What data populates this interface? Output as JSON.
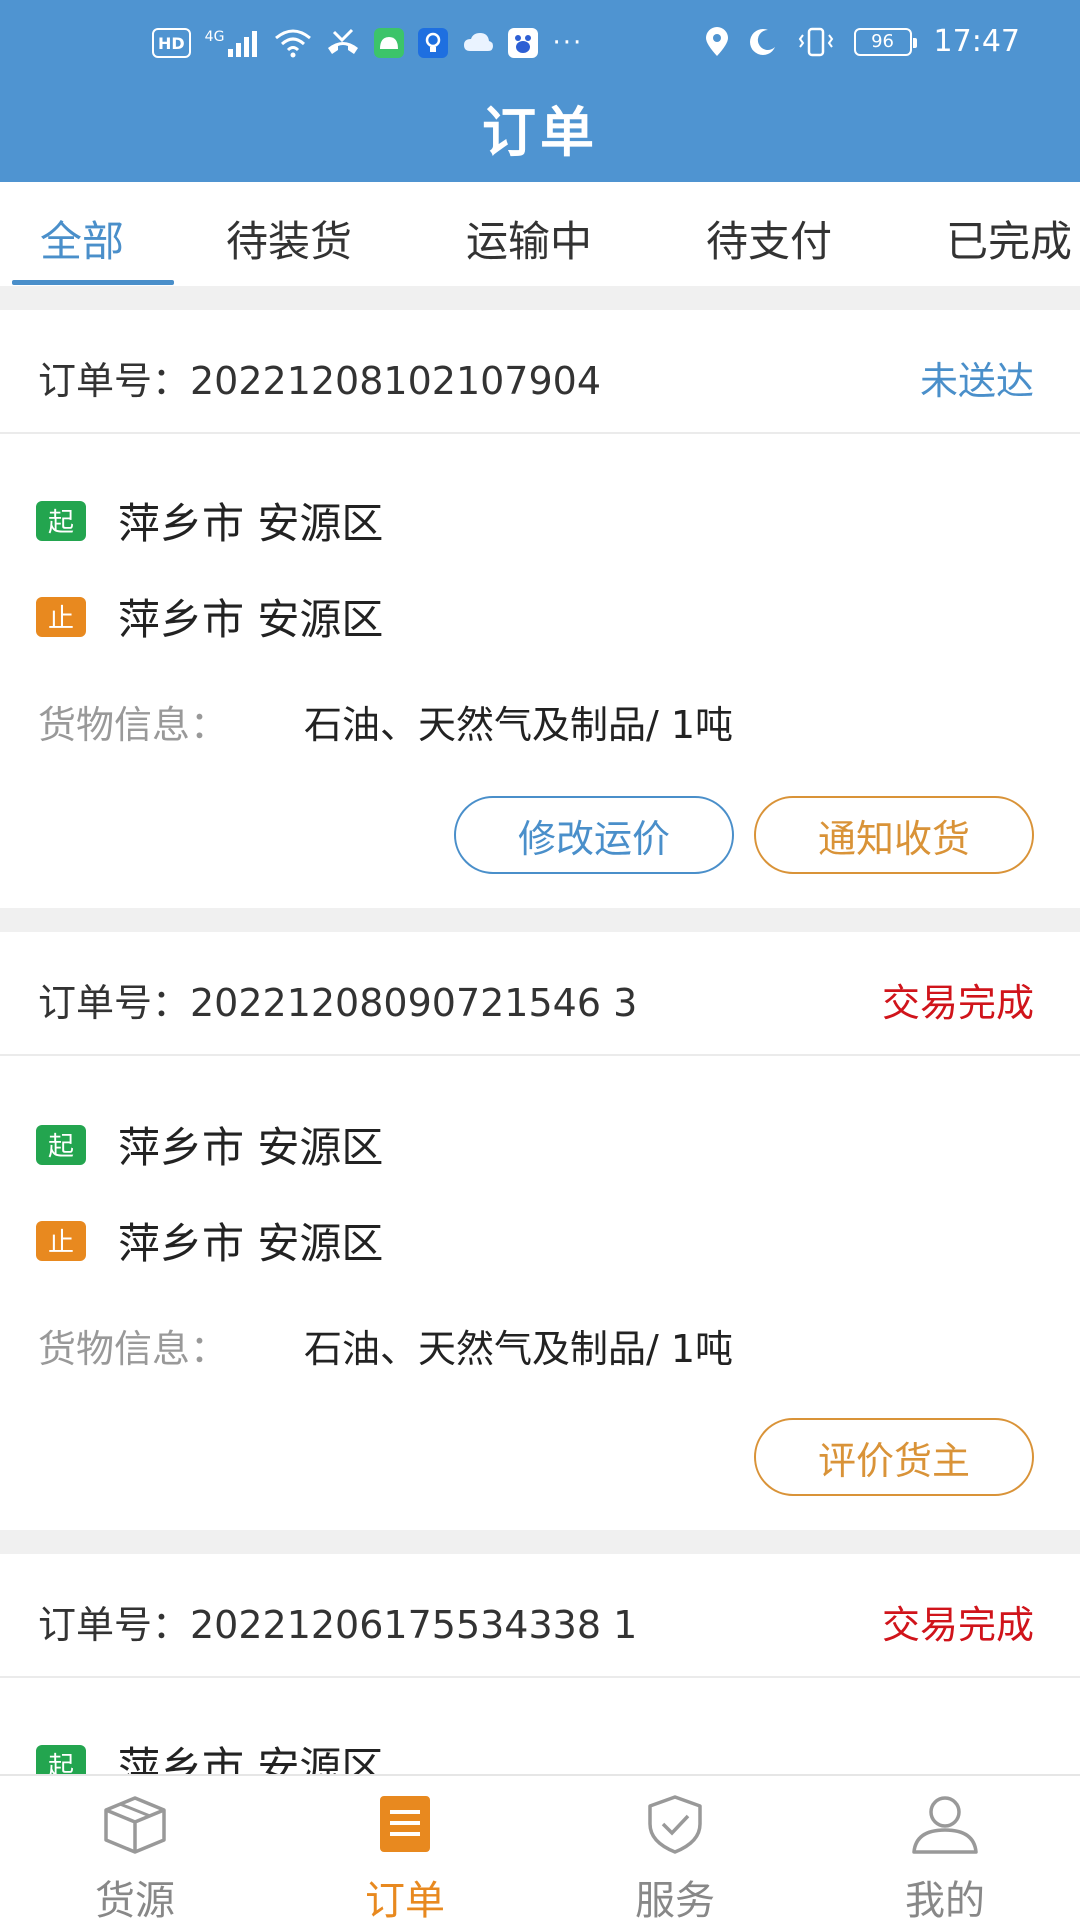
{
  "status_bar": {
    "left_badges": [
      "HD",
      "4G"
    ],
    "battery": "96",
    "time": "17:47"
  },
  "header": {
    "title": "订单"
  },
  "tabs": [
    {
      "label": "全部",
      "active": true
    },
    {
      "label": "待装货",
      "active": false
    },
    {
      "label": "运输中",
      "active": false
    },
    {
      "label": "待支付",
      "active": false
    },
    {
      "label": "已完成",
      "active": false
    }
  ],
  "orders": [
    {
      "order_no": "订单号：20221208102107904",
      "status": "未送达",
      "status_color": "#4a8fca",
      "start_tag": "起",
      "start": "萍乡市 安源区",
      "end_tag": "止",
      "end": "萍乡市 安源区",
      "cargo_label": "货物信息：",
      "cargo_value": "石油、天然气及制品/ 1吨",
      "buttons": [
        "修改运价",
        "通知收货"
      ]
    },
    {
      "order_no": "订单号：20221208090721546 3",
      "status": "交易完成",
      "status_color": "#d0141b",
      "start_tag": "起",
      "start": "萍乡市 安源区",
      "end_tag": "止",
      "end": "萍乡市 安源区",
      "cargo_label": "货物信息：",
      "cargo_value": "石油、天然气及制品/ 1吨",
      "buttons": [
        "评价货主"
      ]
    },
    {
      "order_no": "订单号：20221206175534338 1",
      "status": "交易完成",
      "status_color": "#d0141b",
      "start_tag": "起",
      "start": "萍乡市 安源区"
    }
  ],
  "bottom_nav": [
    {
      "label": "货源",
      "icon": "box-icon",
      "active": false
    },
    {
      "label": "订单",
      "icon": "order-list-icon",
      "active": true
    },
    {
      "label": "服务",
      "icon": "shield-check-icon",
      "active": false
    },
    {
      "label": "我的",
      "icon": "user-icon",
      "active": false
    }
  ],
  "colors": {
    "header_bg": "#4f94d1",
    "accent_blue": "#4a8fca",
    "accent_orange": "#e8891f",
    "status_red": "#d0141b"
  }
}
